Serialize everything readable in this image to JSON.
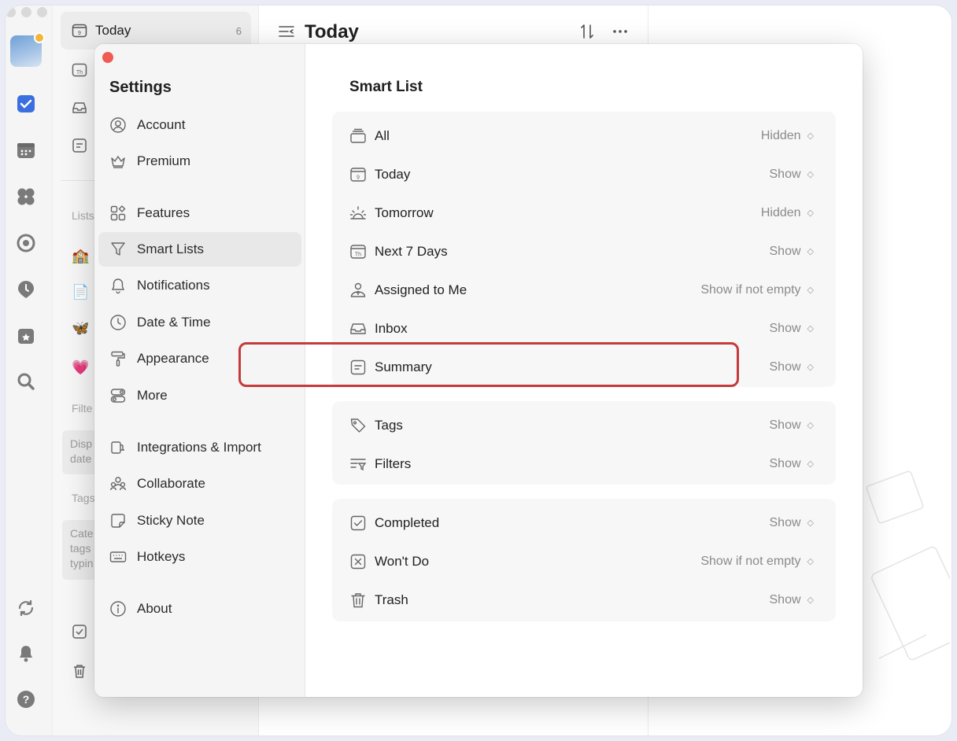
{
  "list_column": {
    "today_label": "Today",
    "today_count": "6",
    "section_lists": "Lists",
    "section_filters": "Filte",
    "filters_card": "Disp date",
    "section_tags": "Tags",
    "tags_card": "Cate tags typin"
  },
  "main": {
    "title": "Today"
  },
  "settings": {
    "title": "Settings",
    "nav": [
      {
        "label": "Account",
        "icon": "account-icon"
      },
      {
        "label": "Premium",
        "icon": "crown-icon"
      },
      {
        "label": "Features",
        "icon": "features-icon"
      },
      {
        "label": "Smart Lists",
        "icon": "filter-icon"
      },
      {
        "label": "Notifications",
        "icon": "bell-icon"
      },
      {
        "label": "Date & Time",
        "icon": "clock-icon"
      },
      {
        "label": "Appearance",
        "icon": "paint-roller-icon"
      },
      {
        "label": "More",
        "icon": "toggles-icon"
      },
      {
        "label": "Integrations & Import",
        "icon": "plug-icon"
      },
      {
        "label": "Collaborate",
        "icon": "people-icon"
      },
      {
        "label": "Sticky Note",
        "icon": "sticky-note-icon"
      },
      {
        "label": "Hotkeys",
        "icon": "keyboard-icon"
      },
      {
        "label": "About",
        "icon": "info-icon"
      }
    ],
    "active_nav": "Smart Lists"
  },
  "smart_list": {
    "title": "Smart List",
    "group1": [
      {
        "label": "All",
        "value": "Hidden",
        "icon": "stack-icon"
      },
      {
        "label": "Today",
        "value": "Show",
        "icon": "calendar-day-icon"
      },
      {
        "label": "Tomorrow",
        "value": "Hidden",
        "icon": "sunrise-icon"
      },
      {
        "label": "Next 7 Days",
        "value": "Show",
        "icon": "calendar-week-icon"
      },
      {
        "label": "Assigned to Me",
        "value": "Show if not empty",
        "icon": "person-icon"
      },
      {
        "label": "Inbox",
        "value": "Show",
        "icon": "inbox-icon"
      },
      {
        "label": "Summary",
        "value": "Show",
        "icon": "summary-icon"
      }
    ],
    "group2": [
      {
        "label": "Tags",
        "value": "Show",
        "icon": "tag-icon"
      },
      {
        "label": "Filters",
        "value": "Show",
        "icon": "filters-icon"
      }
    ],
    "group3": [
      {
        "label": "Completed",
        "value": "Show",
        "icon": "checkbox-icon"
      },
      {
        "label": "Won't Do",
        "value": "Show if not empty",
        "icon": "x-box-icon"
      },
      {
        "label": "Trash",
        "value": "Show",
        "icon": "trash-icon"
      }
    ],
    "highlighted_row": "Summary",
    "highlight_color": "#c53a3a"
  },
  "colors": {
    "accent_blue": "#3b6fe0",
    "close_red": "#ef5b53"
  }
}
